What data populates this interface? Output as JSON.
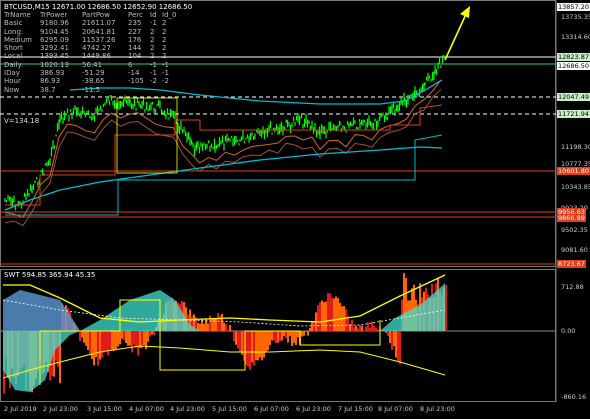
{
  "chart_header": "BTCUSD,M15  12671.00 12686.50 12652.90 12686.50",
  "indicator_header": "SWT 594.85 365.94 45.35",
  "stats_table": {
    "columns": [
      "TrName",
      "TrPower",
      "PartPow",
      "Perc",
      "Id",
      "Id_0"
    ],
    "rows": [
      [
        "Basic",
        "9180.96",
        "21611.07",
        "235",
        "-1",
        "2"
      ],
      [
        "Long:",
        "9104.45",
        "20641.81",
        "227",
        "2",
        "2"
      ],
      [
        "Medium",
        "6295.09",
        "11537.26",
        "176",
        "2",
        "2"
      ],
      [
        "Short",
        "3292.41",
        "4742.27",
        "144",
        "2",
        "2"
      ],
      [
        "Local",
        "1393.45",
        "1449.86",
        "104",
        "2",
        "2"
      ],
      [
        "Daily:",
        "1020.13",
        "56.41",
        "6",
        "-1",
        "-1"
      ],
      [
        "IDay",
        "386.93",
        "-51.29",
        "-14",
        "-1",
        "-1"
      ],
      [
        "Hour",
        "86.93",
        "-38.65",
        "-105",
        "-2",
        "-2"
      ],
      [
        "Now",
        "38.7",
        "-11.5",
        "",
        "",
        ""
      ]
    ],
    "footer": "V=134.18"
  },
  "price_axis": {
    "ticks": [
      "13735.35",
      "13314.60",
      "12686.50",
      "12047.49",
      "11198.30",
      "10777.35",
      "10343.85",
      "9923.20",
      "9502.35",
      "9081.60",
      "8660.85",
      "8240.10"
    ],
    "labels": [
      {
        "text": "13857.20",
        "bg": "#f4f4f4",
        "fg": "#000000"
      },
      {
        "text": "12823.87",
        "bg": "#c8f0c8",
        "fg": "#000000"
      },
      {
        "text": "12686.50",
        "bg": "#ffffff",
        "fg": "#000000"
      },
      {
        "text": "12047.49",
        "bg": "#c8f0c8",
        "fg": "#000000"
      },
      {
        "text": "11721.94",
        "bg": "#c8f0c8",
        "fg": "#000000"
      },
      {
        "text": "10601.80",
        "bg": "#e23c1c",
        "fg": "#ffffff"
      },
      {
        "text": "9956.63",
        "bg": "#e23c1c",
        "fg": "#ffffff"
      },
      {
        "text": "9866.89",
        "bg": "#e23c1c",
        "fg": "#ffffff"
      },
      {
        "text": "8723.67",
        "bg": "#e23c1c",
        "fg": "#ffffff"
      }
    ]
  },
  "indicator_axis": {
    "ticks": [
      "712.88",
      "0.00",
      "-860.16"
    ]
  },
  "time_axis": {
    "ticks": [
      "2 Jul 2019",
      "2 Jul 23:00",
      "3 Jul 15:00",
      "4 Jul 07:00",
      "4 Jul 23:00",
      "5 Jul 15:00",
      "6 Jul 07:00",
      "6 Jul 23:00",
      "7 Jul 15:00",
      "8 Jul 07:00",
      "8 Jul 23:00"
    ]
  },
  "colors": {
    "background": "#000000",
    "candle": "#00ff00",
    "ma_fast": "#d2691e",
    "ma_slow": "#a0522d",
    "band": "#00bcd4",
    "support": "#e23c1c",
    "resistance": "#ffff00",
    "arrow": "#ffff00",
    "hist_orange": "#ff6600",
    "hist_red": "#e11b1b",
    "hist_cyan": "#40e0d0",
    "hist_blue": "#5b9bd5",
    "grid_dot": "#ffffff"
  }
}
